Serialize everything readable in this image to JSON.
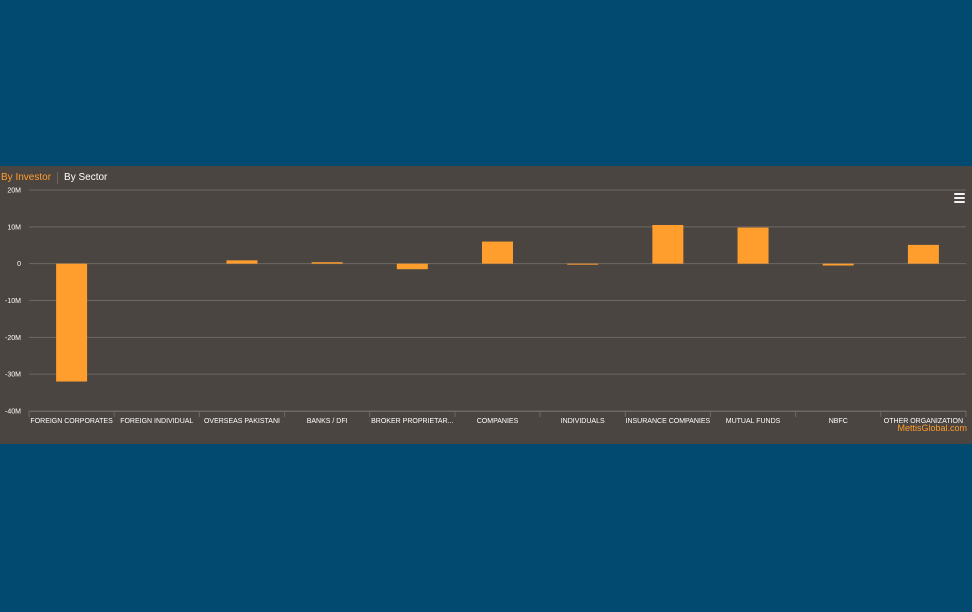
{
  "tabs": [
    {
      "label": "By Investor",
      "active": true
    },
    {
      "label": "By Sector",
      "active": false
    }
  ],
  "menu_icon": "hamburger-menu-icon",
  "credit": "MettisGlobal.com",
  "colors": {
    "page_bg": "#024a70",
    "panel_bg": "#4b4541",
    "bar": "#ff9d2d",
    "grid": "#6e6863",
    "text": "#ffffff",
    "accent": "#ff9d2d"
  },
  "chart_data": {
    "type": "bar",
    "categories": [
      "FOREIGN CORPORATES",
      "FOREIGN INDIVIDUAL",
      "OVERSEAS PAKISTANI",
      "BANKS / DFI",
      "BROKER PROPRIETAR...",
      "COMPANIES",
      "INDIVIDUALS",
      "INSURANCE COMPANIES",
      "MUTUAL FUNDS",
      "NBFC",
      "OTHER ORGANIZATION"
    ],
    "values": [
      -32000000,
      0,
      900000,
      400000,
      -1500000,
      6000000,
      -200000,
      10500000,
      9800000,
      -500000,
      5100000
    ],
    "y_ticks": [
      {
        "value": 20000000,
        "label": "20M"
      },
      {
        "value": 10000000,
        "label": "10M"
      },
      {
        "value": 0,
        "label": "0"
      },
      {
        "value": -10000000,
        "label": "-10M"
      },
      {
        "value": -20000000,
        "label": "-20M"
      },
      {
        "value": -30000000,
        "label": "-30M"
      },
      {
        "value": -40000000,
        "label": "-40M"
      }
    ],
    "ylim": [
      -40000000,
      20000000
    ],
    "grid": true,
    "legend": "none"
  }
}
